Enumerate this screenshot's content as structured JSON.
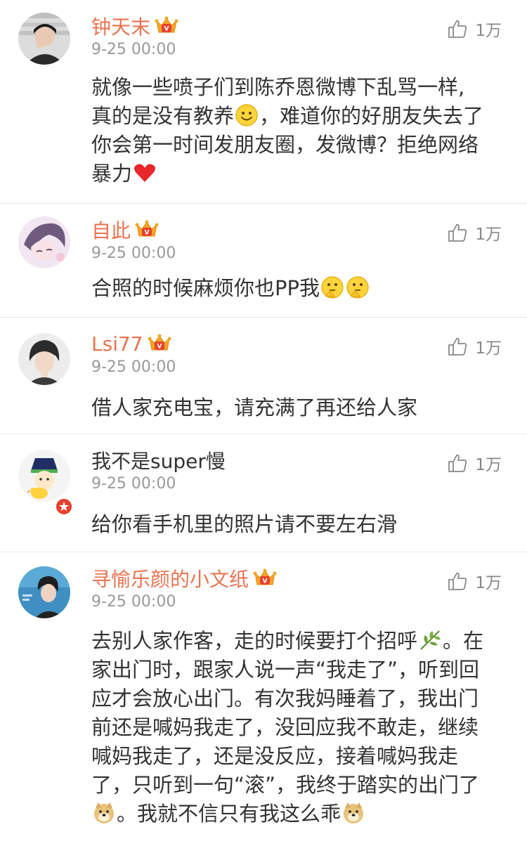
{
  "comments": [
    {
      "username": "钟天末",
      "vip": true,
      "time": "9-25 00:00",
      "likes": "1万",
      "lines": [
        "就像一些喷子们到陈乔恩微博下乱骂一样,",
        "真的是没有教养",
        "，难道你的好朋友失去了",
        "你会第一时间发朋友圈，发微博？拒绝网络",
        "暴力"
      ],
      "emoji": [
        "smile-emoji",
        "red-heart-emoji"
      ]
    },
    {
      "username": "自此",
      "vip": true,
      "time": "9-25 00:00",
      "likes": "1万",
      "lines": [
        "合照的时候麻烦你也PP我"
      ],
      "emoji": [
        "thinking-emoji",
        "thinking-emoji"
      ]
    },
    {
      "username": "Lsi77",
      "vip": true,
      "time": "9-25 00:00",
      "likes": "1万",
      "lines": [
        "借人家充电宝，请充满了再还给人家"
      ]
    },
    {
      "username": "我不是super慢",
      "vip": false,
      "time": "9-25 00:00",
      "likes": "1万",
      "lines": [
        "给你看手机里的照片请不要左右滑"
      ]
    },
    {
      "username": "寻愉乐颜的小文纸",
      "vip": true,
      "time": "9-25 00:00",
      "likes": "1万",
      "lines": [
        "去别人家作客，走的时候要打个招呼",
        "。在",
        "家出门时，跟家人说一声“我走了”，听到回",
        "应才会放心出门。有次我妈睡着了，我出门",
        "前还是喊妈我走了，没回应我不敢走，继续",
        "喊妈我走了，还是没反应，接着喊妈我走",
        "了，只听到一句“滚”，我终于踏实的出门了",
        "。我就不信只有我这么乖"
      ],
      "emoji": [
        "leaf-emoji",
        "doge-emoji",
        "doge-emoji"
      ]
    }
  ],
  "colors": {
    "username": "#eb7350",
    "username_plain": "#333333",
    "time": "#999999",
    "body_text": "#333333",
    "divider": "#e6e6e6"
  }
}
